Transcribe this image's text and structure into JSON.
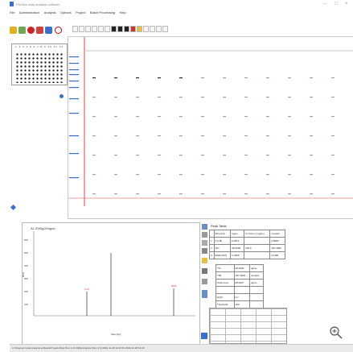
{
  "app": {
    "title": "ProSize data analysis software",
    "window_controls": [
      "–",
      "□",
      "×"
    ]
  },
  "menu": [
    "File",
    "Administration",
    "Analysis",
    "Options",
    "Project",
    "Batch Processing",
    "Help"
  ],
  "plate": {
    "columns": "1 2 3 4 5 6 7 8 9 10 11 12",
    "rows": [
      "A",
      "B",
      "C",
      "D",
      "E",
      "F",
      "G",
      "H"
    ]
  },
  "electropherogram": {
    "title": "A1 20Mg/20ng/uL",
    "y_label": "RFU",
    "x_label": "Size (bp)",
    "y_ticks": [
      "600",
      "500",
      "400",
      "300",
      "200",
      "100"
    ],
    "peaks": [
      {
        "label": "1 bp",
        "x": 0.33,
        "h": 0.3
      },
      {
        "label": "",
        "x": 0.48,
        "h": 0.78
      },
      {
        "label": "6000",
        "x": 0.87,
        "h": 0.34
      }
    ]
  },
  "peak_table": {
    "title": "Peak Table",
    "headers": [
      "",
      "Size (bp)",
      "ng/uL",
      "% (Conc.) (ng/uL)",
      "nmole/L"
    ],
    "rows": [
      [
        "1",
        "1 (LM)",
        "0.2071",
        "",
        "0.6983"
      ],
      [
        "2",
        "297",
        "28.2000",
        "100.0",
        "187.3000"
      ],
      [
        "3",
        "6000 (UM)",
        "0.2660",
        "",
        "0.1105"
      ]
    ],
    "summary": [
      [
        "TIC",
        "28.0000",
        "ng/uL"
      ],
      [
        "TIM",
        "187.3000",
        "nmole/L"
      ],
      [
        "Total Conc.",
        "28.0007",
        "ng/uL"
      ],
      [
        "",
        ""
      ],
      [
        "GQN",
        "1.7",
        ""
      ],
      [
        "Threshold",
        "103",
        ""
      ]
    ]
  },
  "status": "C:\\Fragment data analysis software\\Projects\\Test Run 1.cfr 20Mg Analysis (Run 1.0) 2019-11-28 13:23:01 2019-11-28 13:43"
}
